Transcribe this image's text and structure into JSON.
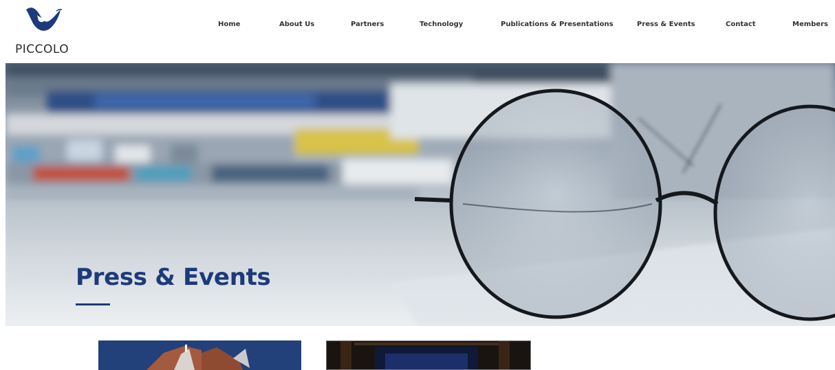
{
  "brand": {
    "name": "PICCOLO",
    "logo_icon": "piccolo-swoosh-logo",
    "colors": {
      "navy": "#1d3a7a",
      "nav_text": "#333333"
    }
  },
  "nav": {
    "items": [
      {
        "label": "Home"
      },
      {
        "label": "About Us"
      },
      {
        "label": "Partners"
      },
      {
        "label": "Technology"
      },
      {
        "label": "Publications & Presentations"
      },
      {
        "label": "Press & Events"
      },
      {
        "label": "Contact"
      },
      {
        "label": "Members"
      }
    ]
  },
  "hero": {
    "title": "Press & Events",
    "image": "blurred-magazines-and-round-eyeglasses"
  },
  "cards": [
    {
      "image": "modern-building-against-blue-sky"
    },
    {
      "image": "dark-lecture-hall-interior"
    }
  ]
}
